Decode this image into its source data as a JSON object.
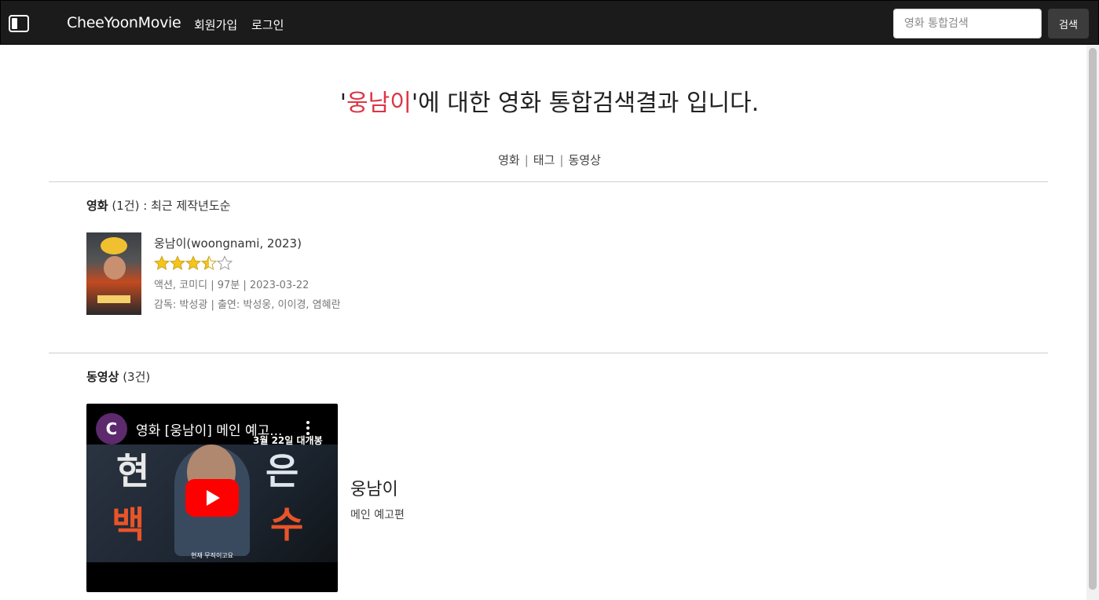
{
  "navbar": {
    "toggle_icon": "sidebar-toggle-icon",
    "brand": "CheeYoonMovie",
    "links": [
      "회원가입",
      "로그인"
    ],
    "search_placeholder": "영화 통합검색",
    "search_button": "검색"
  },
  "heading": {
    "quote_open": "'",
    "keyword": "웅남이",
    "quote_close": "'",
    "suffix": "에 대한 영화 통합검색결과 입니다."
  },
  "tabs": [
    "영화",
    "태그",
    "동영상"
  ],
  "tab_separator": "|",
  "movies_section": {
    "title": "영화",
    "count": "(1건)",
    "sort": ": 최근 제작년도순"
  },
  "movie": {
    "title": "웅남이(woongnami, 2023)",
    "rating": 3.5,
    "rating_max": 5,
    "info": "액션, 코미디 | 97분 | 2023-03-22",
    "credits": "감독: 박성광 | 출연: 박성웅, 이이경, 염혜란"
  },
  "videos_section": {
    "title": "동영상",
    "count": "(3건)"
  },
  "video": {
    "channel_initial": "C",
    "player_title": "영화 [웅남이] 메인 예고...",
    "release_text": "3월 22일 대개봉",
    "caption": "현재 무직이고요",
    "title": "웅남이",
    "subtitle": "메인 예고편"
  },
  "colors": {
    "navbar_bg": "#1b1b1b",
    "keyword": "#dc3545",
    "star": "#f5c518",
    "play": "#ff0000"
  }
}
